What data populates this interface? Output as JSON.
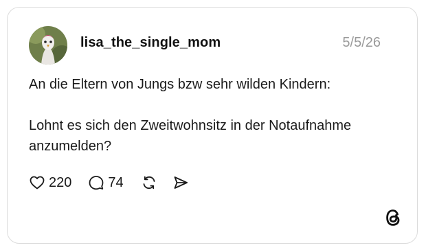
{
  "post": {
    "username": "lisa_the_single_mom",
    "date": "5/5/26",
    "text": "An die Eltern von Jungs bzw sehr wilden Kindern:\n\nLohnt es sich den Zweitwohnsitz in der Notaufnahme anzumelden?",
    "likes": "220",
    "replies": "74"
  },
  "icons": {
    "like": "heart-icon",
    "reply": "speech-bubble-icon",
    "repost": "repost-icon",
    "share": "send-icon",
    "brand": "threads-logo"
  },
  "colors": {
    "text": "#1a1a1a",
    "muted": "#9a9a9a",
    "border": "#dcdcdc"
  }
}
